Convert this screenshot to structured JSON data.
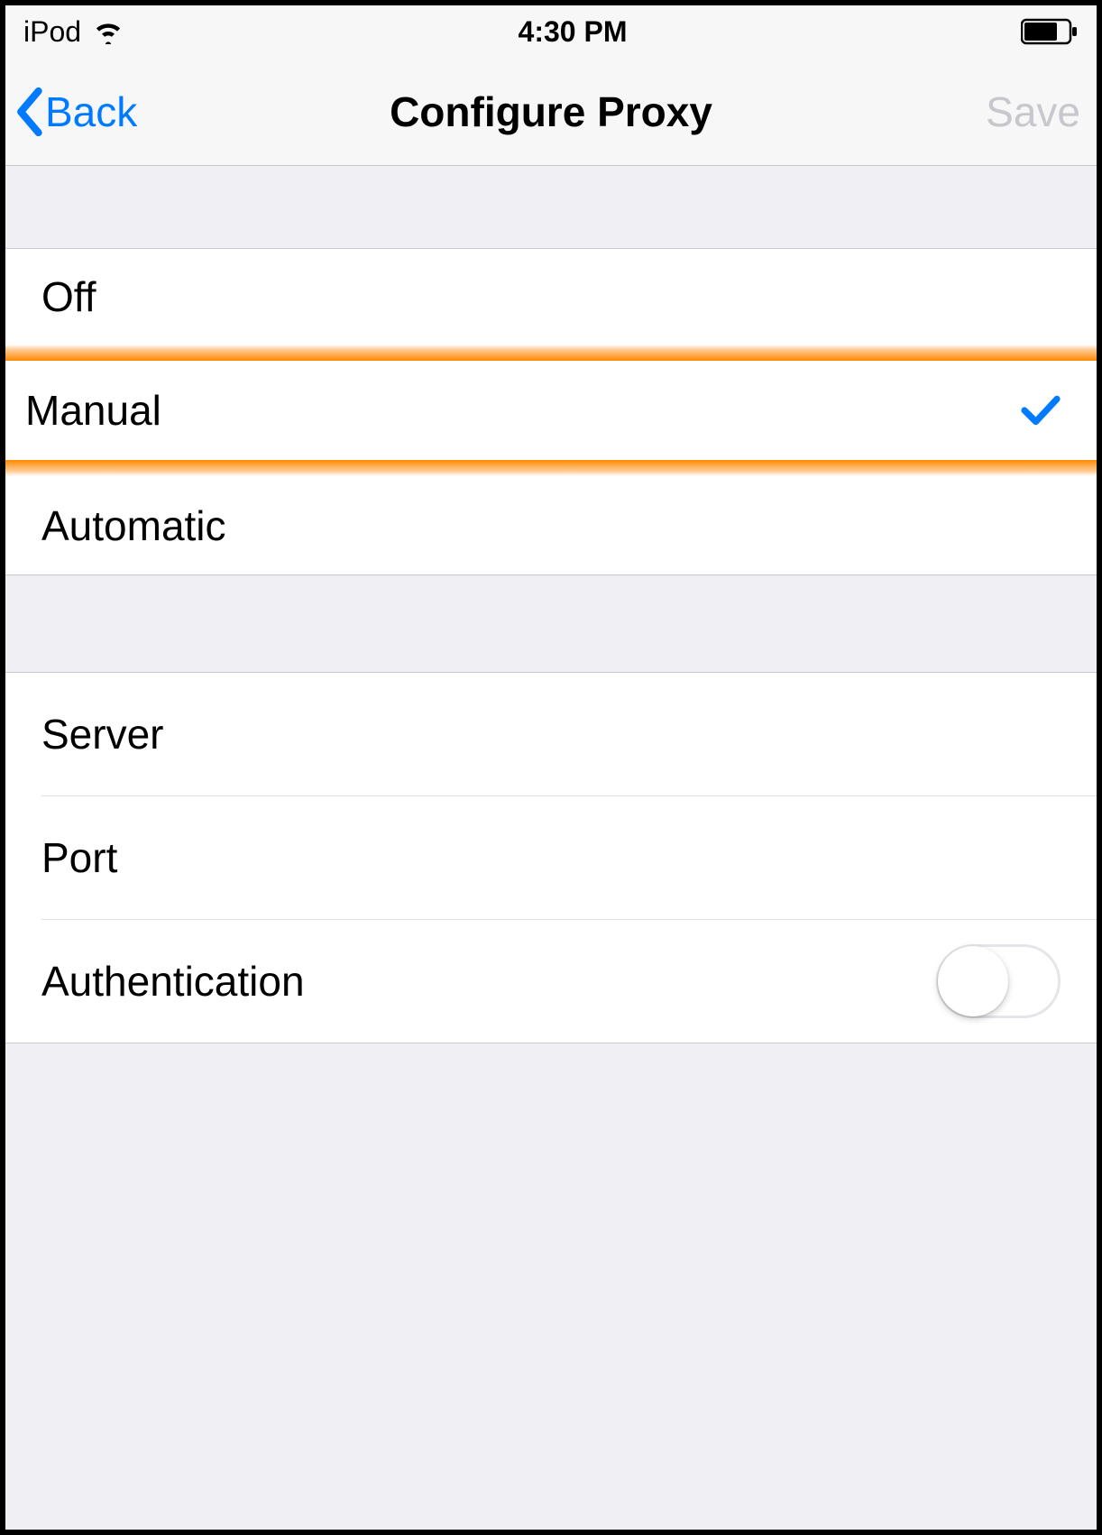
{
  "status_bar": {
    "carrier": "iPod",
    "time": "4:30 PM"
  },
  "nav": {
    "back_label": "Back",
    "title": "Configure Proxy",
    "save_label": "Save"
  },
  "proxy_options": {
    "off": "Off",
    "manual": "Manual",
    "automatic": "Automatic",
    "selected": "Manual"
  },
  "config_fields": {
    "server_label": "Server",
    "port_label": "Port",
    "auth_label": "Authentication",
    "auth_value": false
  }
}
